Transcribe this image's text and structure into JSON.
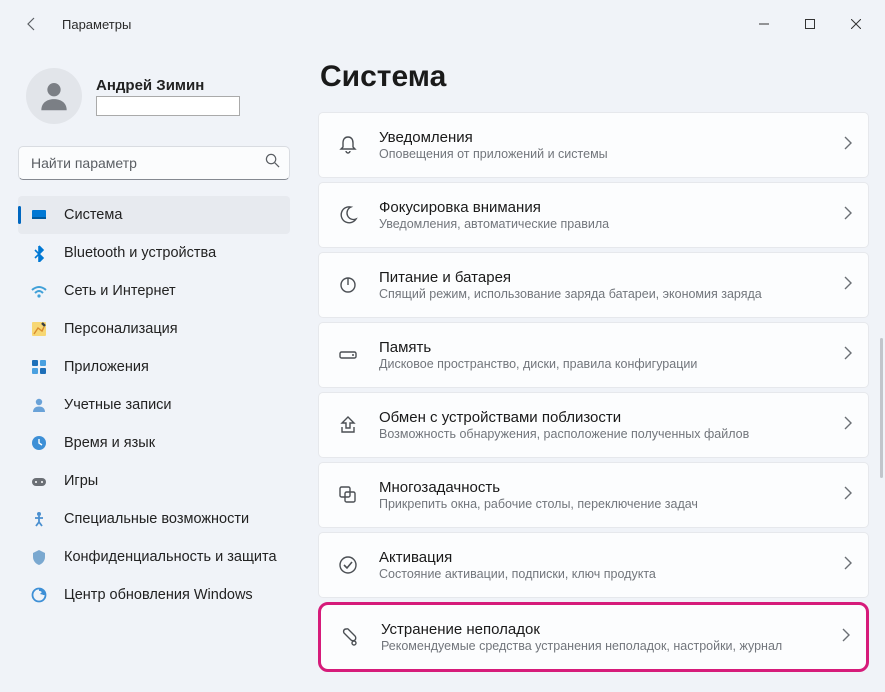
{
  "app_title": "Параметры",
  "user": {
    "name": "Андрей Зимин"
  },
  "search": {
    "placeholder": "Найти параметр"
  },
  "nav": [
    {
      "label": "Система",
      "icon": "system",
      "active": true
    },
    {
      "label": "Bluetooth и устройства",
      "icon": "bluetooth",
      "active": false
    },
    {
      "label": "Сеть и Интернет",
      "icon": "network",
      "active": false
    },
    {
      "label": "Персонализация",
      "icon": "personalization",
      "active": false
    },
    {
      "label": "Приложения",
      "icon": "apps",
      "active": false
    },
    {
      "label": "Учетные записи",
      "icon": "accounts",
      "active": false
    },
    {
      "label": "Время и язык",
      "icon": "time",
      "active": false
    },
    {
      "label": "Игры",
      "icon": "gaming",
      "active": false
    },
    {
      "label": "Специальные возможности",
      "icon": "accessibility",
      "active": false
    },
    {
      "label": "Конфиденциальность и защита",
      "icon": "privacy",
      "active": false
    },
    {
      "label": "Центр обновления Windows",
      "icon": "update",
      "active": false
    }
  ],
  "page": {
    "title": "Система"
  },
  "cards": [
    {
      "icon": "bell",
      "title": "Уведомления",
      "desc": "Оповещения от приложений и системы",
      "highlight": false
    },
    {
      "icon": "moon",
      "title": "Фокусировка внимания",
      "desc": "Уведомления, автоматические правила",
      "highlight": false
    },
    {
      "icon": "power",
      "title": "Питание и батарея",
      "desc": "Спящий режим, использование заряда батареи, экономия заряда",
      "highlight": false
    },
    {
      "icon": "storage",
      "title": "Память",
      "desc": "Дисковое пространство, диски, правила конфигурации",
      "highlight": false
    },
    {
      "icon": "share",
      "title": "Обмен с устройствами поблизости",
      "desc": "Возможность обнаружения, расположение полученных файлов",
      "highlight": false
    },
    {
      "icon": "multitask",
      "title": "Многозадачность",
      "desc": "Прикрепить окна, рабочие столы, переключение задач",
      "highlight": false
    },
    {
      "icon": "activation",
      "title": "Активация",
      "desc": "Состояние активации, подписки, ключ продукта",
      "highlight": false
    },
    {
      "icon": "troubleshoot",
      "title": "Устранение неполадок",
      "desc": "Рекомендуемые средства устранения неполадок, настройки, журнал",
      "highlight": true
    }
  ]
}
